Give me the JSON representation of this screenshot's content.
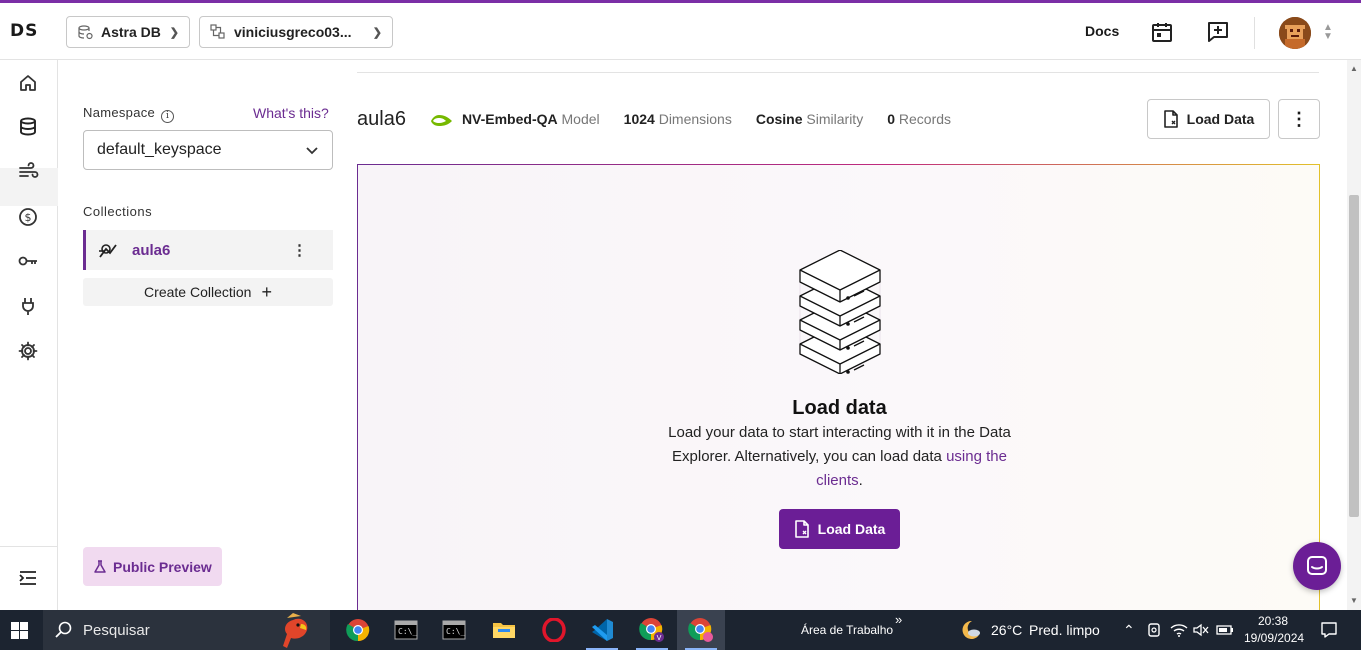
{
  "topbar": {
    "logo": "DS",
    "db_selector": "Astra DB",
    "org_selector": "viniciusgreco03...",
    "docs_label": "Docs"
  },
  "sidebar": {
    "namespace_label": "Namespace",
    "whats_this": "What's this?",
    "namespace_value": "default_keyspace",
    "collections_label": "Collections",
    "collections": [
      {
        "name": "aula6"
      }
    ],
    "create_collection": "Create Collection",
    "public_preview": "Public Preview"
  },
  "collection_header": {
    "title": "aula6",
    "model_name": "NV-Embed-QA",
    "model_suffix": "Model",
    "dimensions_value": "1024",
    "dimensions_label": "Dimensions",
    "similarity_value": "Cosine",
    "similarity_label": "Similarity",
    "records_value": "0",
    "records_label": "Records",
    "load_data_button": "Load Data"
  },
  "empty_state": {
    "title": "Load data",
    "description_1": "Load your data to start interacting with it in the Data Explorer. Alternatively, you can load data",
    "link": "using the clients",
    "description_end": ".",
    "button": "Load Data"
  },
  "taskbar": {
    "search_placeholder": "Pesquisar",
    "desktop_label": "Área de Trabalho",
    "chevron": "»",
    "weather": "26°C",
    "weather_desc": "Pred. limpo",
    "time": "20:38",
    "date": "19/09/2024"
  },
  "colors": {
    "accent": "#6b2c91",
    "primary_button": "#6b1e96",
    "taskbar": "#1c2430"
  }
}
